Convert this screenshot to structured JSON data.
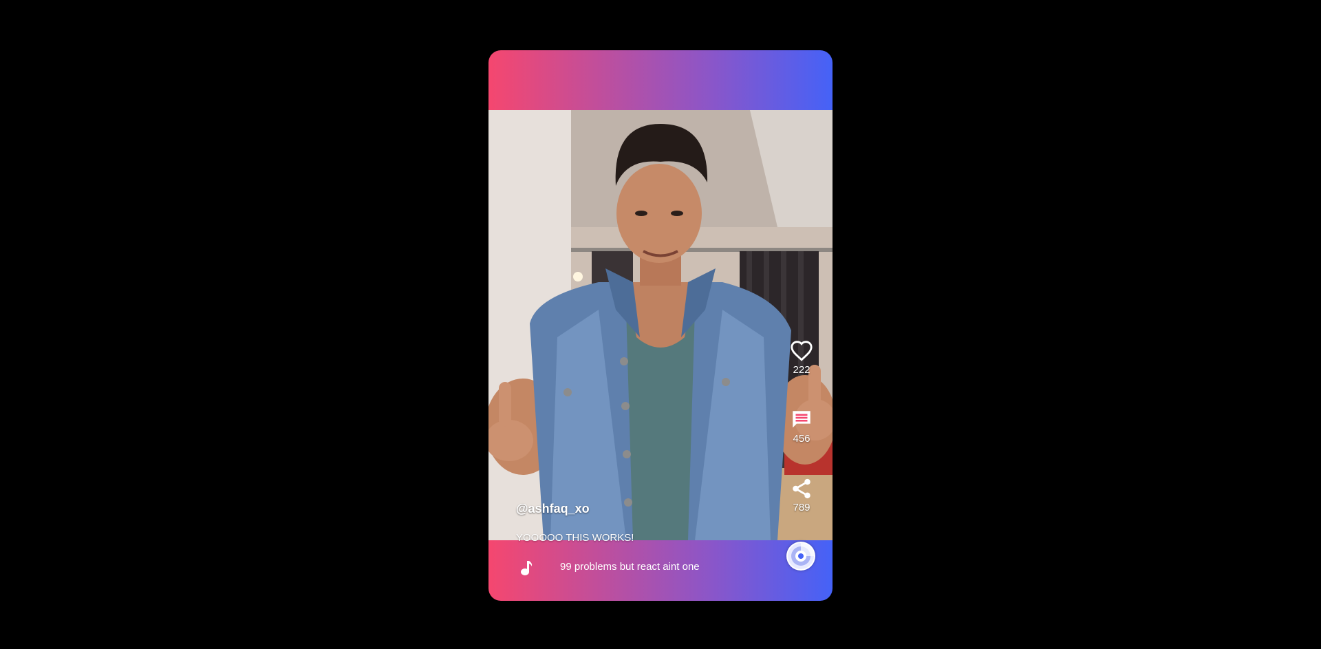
{
  "post": {
    "username": "@ashfaq_xo",
    "caption": "YOOOOO THIS WORKS!",
    "song": "99 problems but react aint one"
  },
  "actions": {
    "likes": "222",
    "comments": "456",
    "shares": "789"
  },
  "icons": {
    "like": "heart-icon",
    "comment": "comment-icon",
    "share": "share-icon",
    "music": "music-note-icon",
    "disc": "record-disc-icon"
  },
  "colors": {
    "gradient_start": "#f5476f",
    "gradient_mid": "#8a56c9",
    "gradient_end": "#4562f7",
    "background": "#000000"
  }
}
